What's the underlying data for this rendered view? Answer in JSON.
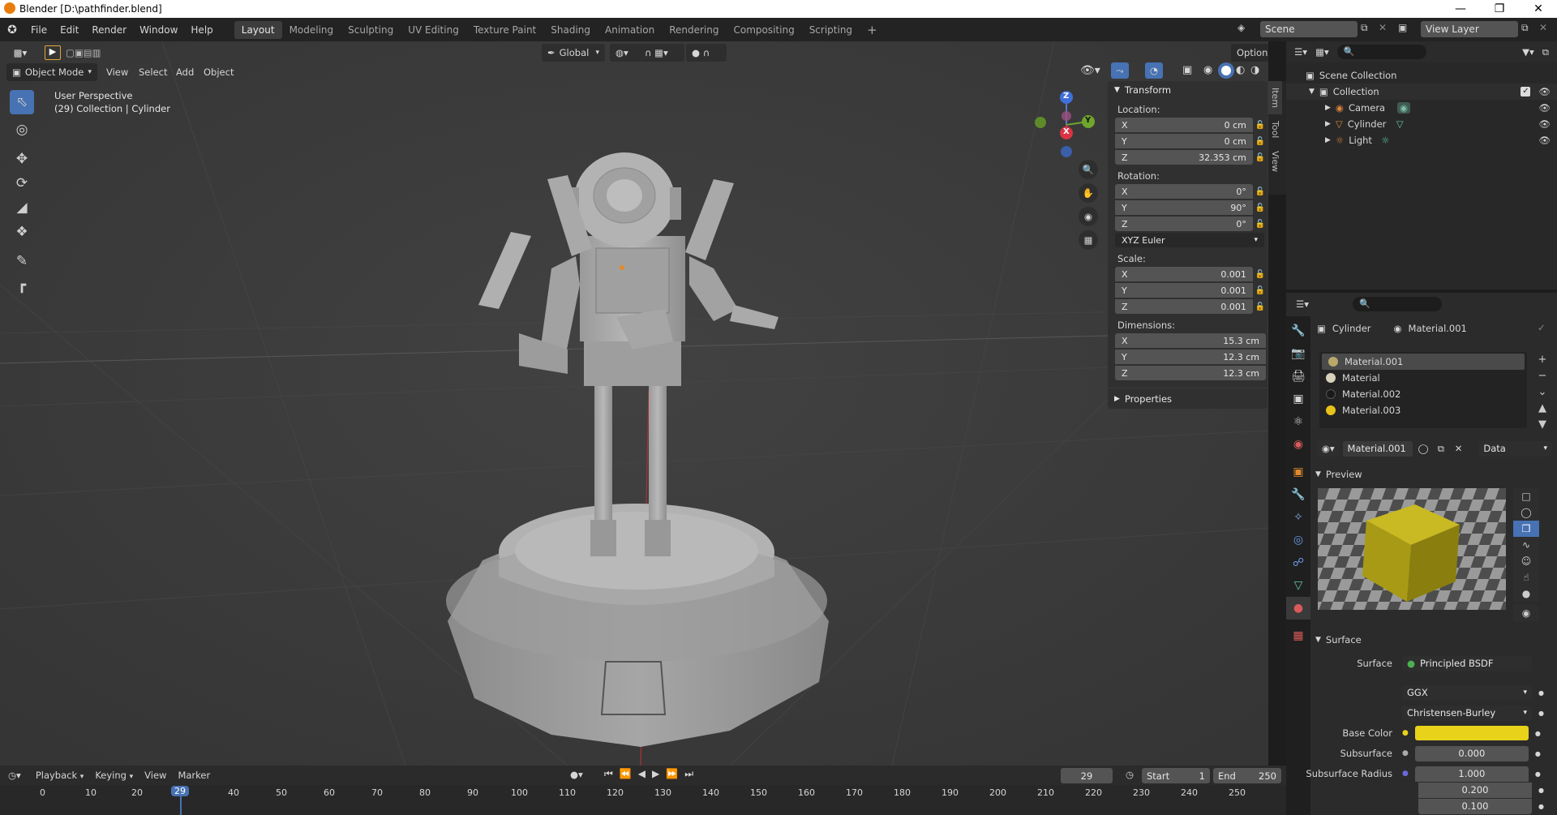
{
  "window": {
    "title": "Blender [D:\\pathfinder.blend]"
  },
  "menu": [
    "File",
    "Edit",
    "Render",
    "Window",
    "Help"
  ],
  "workspaces": [
    "Layout",
    "Modeling",
    "Sculpting",
    "UV Editing",
    "Texture Paint",
    "Shading",
    "Animation",
    "Rendering",
    "Compositing",
    "Scripting"
  ],
  "active_workspace": "Layout",
  "scene": {
    "name": "Scene",
    "view_layer": "View Layer"
  },
  "viewport_header": {
    "orientation": "Global",
    "options": "Options",
    "mode": "Object Mode",
    "menus": [
      "View",
      "Select",
      "Add",
      "Object"
    ]
  },
  "viewport_overlay": {
    "perspective": "User Perspective",
    "collection": "(29) Collection | Cylinder"
  },
  "gizmo": {
    "x": "X",
    "y": "Y",
    "z": "Z"
  },
  "transform": {
    "title": "Transform",
    "location_label": "Location:",
    "location": [
      {
        "axis": "X",
        "value": "0 cm"
      },
      {
        "axis": "Y",
        "value": "0 cm"
      },
      {
        "axis": "Z",
        "value": "32.353 cm"
      }
    ],
    "rotation_label": "Rotation:",
    "rotation": [
      {
        "axis": "X",
        "value": "0°"
      },
      {
        "axis": "Y",
        "value": "90°"
      },
      {
        "axis": "Z",
        "value": "0°"
      }
    ],
    "rotation_mode": "XYZ Euler",
    "scale_label": "Scale:",
    "scale": [
      {
        "axis": "X",
        "value": "0.001"
      },
      {
        "axis": "Y",
        "value": "0.001"
      },
      {
        "axis": "Z",
        "value": "0.001"
      }
    ],
    "dimensions_label": "Dimensions:",
    "dimensions": [
      {
        "axis": "X",
        "value": "15.3 cm"
      },
      {
        "axis": "Y",
        "value": "12.3 cm"
      },
      {
        "axis": "Z",
        "value": "12.3 cm"
      }
    ],
    "properties_title": "Properties"
  },
  "npanel_tabs": [
    "Item",
    "Tool",
    "View"
  ],
  "outliner": {
    "root": "Scene Collection",
    "collection": "Collection",
    "items": [
      {
        "name": "Camera",
        "color": "#d9843b"
      },
      {
        "name": "Cylinder",
        "color": "#d9843b"
      },
      {
        "name": "Light",
        "color": "#d9843b"
      }
    ]
  },
  "properties": {
    "object": "Cylinder",
    "material": "Material.001",
    "slots": [
      {
        "name": "Material.001",
        "color": "#b8a96a"
      },
      {
        "name": "Material",
        "color": "#d8d0b8"
      },
      {
        "name": "Material.002",
        "color": "#1a1a1a"
      },
      {
        "name": "Material.003",
        "color": "#e8c21a"
      }
    ],
    "link": "Data",
    "preview_title": "Preview",
    "surface_title": "Surface",
    "surface_label": "Surface",
    "surface_value": "Principled BSDF",
    "distribution": "GGX",
    "subsurface_method": "Christensen-Burley",
    "base_color_label": "Base Color",
    "base_color": "#e8d21a",
    "subsurface_label": "Subsurface",
    "subsurface_value": "0.000",
    "subsurface_radius_label": "Subsurface Radius",
    "subsurface_radius": [
      "1.000",
      "0.200",
      "0.100"
    ]
  },
  "timeline": {
    "menus": [
      "Playback",
      "Keying",
      "View",
      "Marker"
    ],
    "current_frame": "29",
    "start_label": "Start",
    "start": "1",
    "end_label": "End",
    "end": "250",
    "ticks": [
      "0",
      "10",
      "20",
      "29",
      "40",
      "50",
      "60",
      "70",
      "80",
      "90",
      "100",
      "110",
      "120",
      "130",
      "140",
      "150",
      "160",
      "170",
      "180",
      "190",
      "200",
      "210",
      "220",
      "230",
      "240",
      "250"
    ]
  }
}
